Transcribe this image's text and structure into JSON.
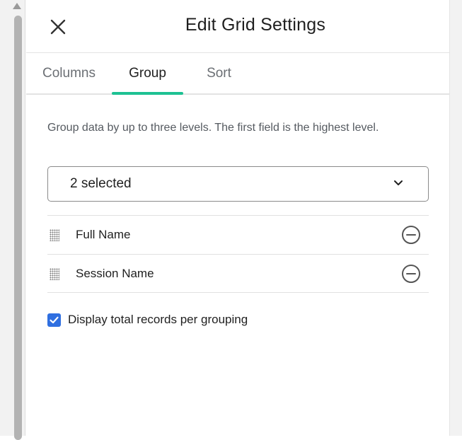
{
  "header": {
    "title": "Edit Grid Settings",
    "close_icon": "close-icon"
  },
  "tabs": [
    {
      "label": "Columns",
      "active": false
    },
    {
      "label": "Group",
      "active": true
    },
    {
      "label": "Sort",
      "active": false
    }
  ],
  "group": {
    "description": "Group data by up to three levels. The first field is the highest level.",
    "select": {
      "value": "2 selected",
      "icon": "chevron-down-icon"
    },
    "items": [
      {
        "label": "Full Name"
      },
      {
        "label": "Session Name"
      }
    ],
    "display_totals": {
      "label": "Display total records per grouping",
      "checked": true
    }
  },
  "colors": {
    "accent": "#1dc193",
    "checkbox": "#2f6fe0",
    "text": "#1f1f1f",
    "muted": "#6b6f74"
  }
}
